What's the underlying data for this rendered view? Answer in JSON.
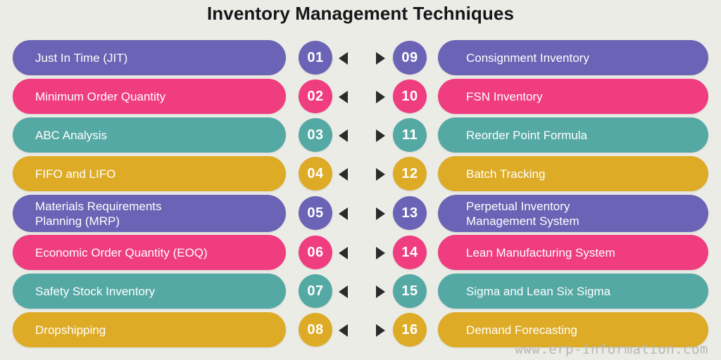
{
  "header": {
    "title": "Inventory Management Techniques"
  },
  "colors": {
    "background": "#ecece7",
    "title_text": "#16161a",
    "bar_text": "#ffffff",
    "arrow": "#2b2b2b",
    "watermark_text": "#b8b8b0",
    "purple": "#6b63b5",
    "pink": "#ef3d7f",
    "teal": "#55a9a4",
    "gold": "#ddab26"
  },
  "rows": [
    {
      "left": {
        "number": "01",
        "label": "Just In Time (JIT)",
        "color": "purple"
      },
      "right": {
        "number": "09",
        "label": "Consignment Inventory",
        "color": "purple"
      },
      "arrow_left": "arrow-left-icon",
      "arrow_right": "arrow-right-icon",
      "tall": false
    },
    {
      "left": {
        "number": "02",
        "label": "Minimum Order Quantity",
        "color": "pink"
      },
      "right": {
        "number": "10",
        "label": "FSN Inventory",
        "color": "pink"
      },
      "arrow_left": "arrow-left-icon",
      "arrow_right": "arrow-right-icon",
      "tall": false
    },
    {
      "left": {
        "number": "03",
        "label": "ABC Analysis",
        "color": "teal"
      },
      "right": {
        "number": "11",
        "label": "Reorder Point Formula",
        "color": "teal"
      },
      "arrow_left": "arrow-left-icon",
      "arrow_right": "arrow-right-icon",
      "tall": false
    },
    {
      "left": {
        "number": "04",
        "label": "FIFO and LIFO",
        "color": "gold"
      },
      "right": {
        "number": "12",
        "label": "Batch Tracking",
        "color": "gold"
      },
      "arrow_left": "arrow-left-icon",
      "arrow_right": "arrow-right-icon",
      "tall": false
    },
    {
      "left": {
        "number": "05",
        "label": "Materials Requirements\nPlanning (MRP)",
        "color": "purple"
      },
      "right": {
        "number": "13",
        "label": "Perpetual Inventory\nManagement System",
        "color": "purple"
      },
      "arrow_left": "arrow-left-icon",
      "arrow_right": "arrow-right-icon",
      "tall": true
    },
    {
      "left": {
        "number": "06",
        "label": "Economic Order Quantity (EOQ)",
        "color": "pink"
      },
      "right": {
        "number": "14",
        "label": "Lean Manufacturing System",
        "color": "pink"
      },
      "arrow_left": "arrow-left-icon",
      "arrow_right": "arrow-right-icon",
      "tall": false
    },
    {
      "left": {
        "number": "07",
        "label": "Safety Stock Inventory",
        "color": "teal"
      },
      "right": {
        "number": "15",
        "label": "Sigma and Lean Six Sigma",
        "color": "teal"
      },
      "arrow_left": "arrow-left-icon",
      "arrow_right": "arrow-right-icon",
      "tall": false
    },
    {
      "left": {
        "number": "08",
        "label": "Dropshipping",
        "color": "gold"
      },
      "right": {
        "number": "16",
        "label": "Demand Forecasting",
        "color": "gold"
      },
      "arrow_left": "arrow-left-icon",
      "arrow_right": "arrow-right-icon",
      "tall": false
    }
  ],
  "footer": {
    "watermark": "www.erp-information.com"
  }
}
